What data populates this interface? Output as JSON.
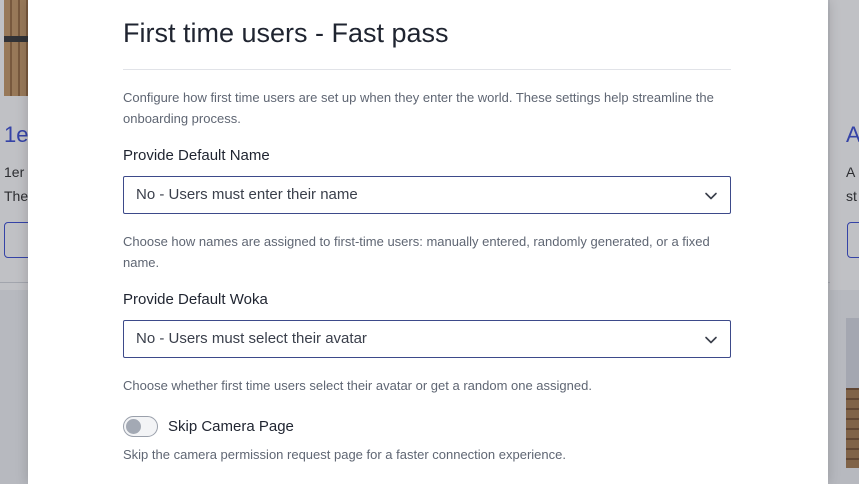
{
  "background": {
    "left_card": {
      "title": "1e",
      "desc_line1": "1er",
      "desc_line2": "The"
    },
    "right_card": {
      "title": "A",
      "desc_line1": "A",
      "desc_line2": "st"
    }
  },
  "modal": {
    "title": "First time users - Fast pass",
    "intro": "Configure how first time users are set up when they enter the world. These settings help streamline the onboarding process.",
    "default_name": {
      "label": "Provide Default Name",
      "selected": "No - Users must enter their name",
      "help": "Choose how names are assigned to first-time users: manually entered, randomly generated, or a fixed name."
    },
    "default_woka": {
      "label": "Provide Default Woka",
      "selected": "No - Users must select their avatar",
      "help": "Choose whether first time users select their avatar or get a random one assigned."
    },
    "skip_camera": {
      "label": "Skip Camera Page",
      "enabled": false,
      "help": "Skip the camera permission request page for a faster connection experience."
    }
  },
  "icons": {
    "select_arrow": "chevron-down-icon"
  },
  "colors": {
    "accent": "#3f51d6",
    "select_border": "#3d4a8a",
    "text_primary": "#1f2430",
    "text_muted": "#5f6673"
  }
}
